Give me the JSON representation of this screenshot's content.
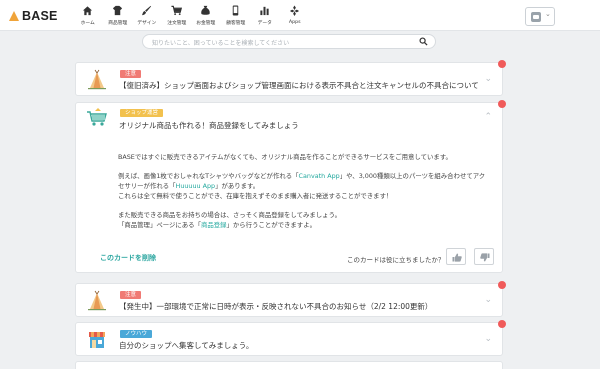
{
  "header": {
    "logo_text": "BASE",
    "nav": [
      {
        "label": "ホーム",
        "icon": "home-icon"
      },
      {
        "label": "商品管理",
        "icon": "shirt-icon"
      },
      {
        "label": "デザイン",
        "icon": "brush-icon"
      },
      {
        "label": "注文管理",
        "icon": "cart-icon"
      },
      {
        "label": "お金管理",
        "icon": "money-bag-icon"
      },
      {
        "label": "顧客管理",
        "icon": "phone-icon"
      },
      {
        "label": "データ",
        "icon": "chart-icon"
      },
      {
        "label": "Apps",
        "icon": "apps-icon"
      }
    ],
    "account_icon": "shop-avatar-icon"
  },
  "search": {
    "placeholder": "知りたいこと、困っていることを検索してください"
  },
  "cards": [
    {
      "tag": "注意",
      "tag_color": "#f07a74",
      "title": "【復旧済み】ショップ画面およびショップ管理画面における表示不具合と注文キャンセルの不具合について",
      "icon": "teepee-icon",
      "unread": true
    },
    {
      "tag": "ショップ運営",
      "tag_color": "#f2c14e",
      "title": "オリジナル商品も作れる！商品登録をしてみましょう",
      "icon": "shopping-cart-illustration-icon",
      "unread": true,
      "expanded": true,
      "body": {
        "p1": "BASEではすぐに販売できるアイテムがなくても、オリジナル商品を作ることができるサービスをご用意しています。",
        "p2a": "例えば、画像1枚でおしゃれなTシャツやバッグなどが作れる「",
        "p2_link1": "Canvath App",
        "p2b": "」や、3,000種類以上のパーツを組み合わせてアク",
        "p2c": "セサリーが作れる「",
        "p2_link2": "Huuuuu App",
        "p2d": "」があります。",
        "p2e": "これらは全て無料で使うことができ、在庫を抱えずそのまま購入者に発送することができます！",
        "p3a": "また販売できる商品をお持ちの場合は、さっそく商品登録をしてみましょう。",
        "p3b": "「商品管理」ページにある「",
        "p3_link": "商品登録",
        "p3c": "」から行うことができますよ。"
      },
      "delete_label": "このカードを削除",
      "helpful_question": "このカードは役に立ちましたか？"
    },
    {
      "tag": "注意",
      "tag_color": "#f07a74",
      "title": "【発生中】一部環境で正常に日時が表示・反映されない不具合のお知らせ（2/2 12:00更新）",
      "icon": "teepee-icon",
      "unread": true
    },
    {
      "tag": "ノウハウ",
      "tag_color": "#4aa8d8",
      "title": "自分のショップへ集客してみましょう。",
      "icon": "storefront-icon",
      "unread": true
    }
  ]
}
